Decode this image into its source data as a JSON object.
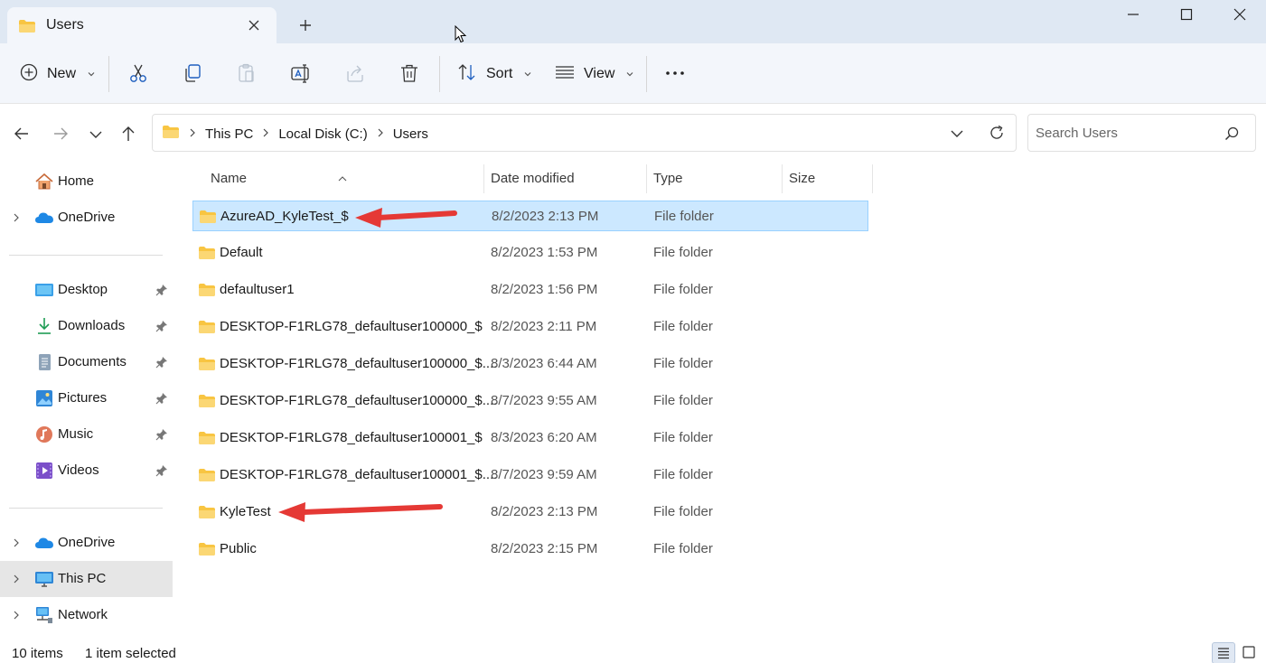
{
  "window": {
    "tab_title": "Users",
    "colors": {
      "accent": "#0067c0",
      "selection_bg": "#cce8ff",
      "selection_border": "#99d1ff",
      "folder": "#f8c542",
      "annotation_arrow": "#e53935"
    }
  },
  "toolbar": {
    "new_label": "New",
    "sort_label": "Sort",
    "view_label": "View",
    "icons": [
      "plus-circle-icon",
      "cut-icon",
      "copy-icon",
      "paste-icon",
      "rename-icon",
      "share-icon",
      "delete-icon",
      "sort-icon",
      "view-icon",
      "more-icon"
    ]
  },
  "address": {
    "crumbs": [
      "This PC",
      "Local Disk (C:)",
      "Users"
    ]
  },
  "search": {
    "placeholder": "Search Users"
  },
  "sidebar": {
    "items": [
      {
        "label": "Home",
        "icon": "home-icon"
      },
      {
        "label": "OneDrive",
        "icon": "cloud-icon"
      },
      {
        "label": "Desktop",
        "icon": "desktop-icon"
      },
      {
        "label": "Downloads",
        "icon": "download-icon"
      },
      {
        "label": "Documents",
        "icon": "document-icon"
      },
      {
        "label": "Pictures",
        "icon": "picture-icon"
      },
      {
        "label": "Music",
        "icon": "music-icon"
      },
      {
        "label": "Videos",
        "icon": "video-icon"
      },
      {
        "label": "OneDrive",
        "icon": "cloud-icon"
      },
      {
        "label": "This PC",
        "icon": "monitor-icon"
      },
      {
        "label": "Network",
        "icon": "network-icon"
      }
    ]
  },
  "columns": {
    "name": "Name",
    "date": "Date modified",
    "type": "Type",
    "size": "Size"
  },
  "files": [
    {
      "name": "AzureAD_KyleTest_$",
      "date": "8/2/2023 2:13 PM",
      "type": "File folder",
      "selected": true
    },
    {
      "name": "Default",
      "date": "8/2/2023 1:53 PM",
      "type": "File folder",
      "selected": false
    },
    {
      "name": "defaultuser1",
      "date": "8/2/2023 1:56 PM",
      "type": "File folder",
      "selected": false
    },
    {
      "name": "DESKTOP-F1RLG78_defaultuser100000_$",
      "date": "8/2/2023 2:11 PM",
      "type": "File folder",
      "selected": false
    },
    {
      "name": "DESKTOP-F1RLG78_defaultuser100000_$....",
      "date": "8/3/2023 6:44 AM",
      "type": "File folder",
      "selected": false
    },
    {
      "name": "DESKTOP-F1RLG78_defaultuser100000_$....",
      "date": "8/7/2023 9:55 AM",
      "type": "File folder",
      "selected": false
    },
    {
      "name": "DESKTOP-F1RLG78_defaultuser100001_$",
      "date": "8/3/2023 6:20 AM",
      "type": "File folder",
      "selected": false
    },
    {
      "name": "DESKTOP-F1RLG78_defaultuser100001_$....",
      "date": "8/7/2023 9:59 AM",
      "type": "File folder",
      "selected": false
    },
    {
      "name": "KyleTest",
      "date": "8/2/2023 2:13 PM",
      "type": "File folder",
      "selected": false
    },
    {
      "name": "Public",
      "date": "8/2/2023 2:15 PM",
      "type": "File folder",
      "selected": false
    }
  ],
  "status": {
    "count": "10 items",
    "selection": "1 item selected"
  }
}
